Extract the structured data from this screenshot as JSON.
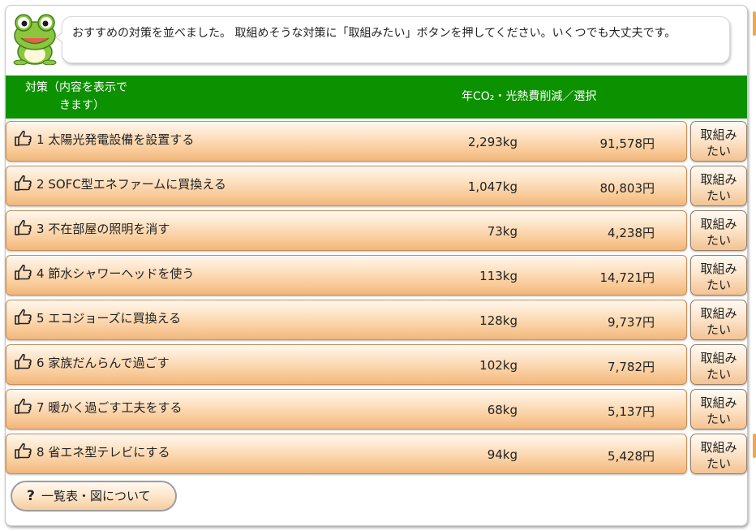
{
  "message": "おすすめの対策を並べました。 取組めそうな対策に「取組みたい」ボタンを押してください。いくつでも大丈夫です。",
  "header": {
    "action_line1": "対策（内容を表示で",
    "action_line2": "きます）",
    "values_label": "年CO₂・光熱費削減／選択"
  },
  "measures": [
    {
      "no": "1",
      "name": "太陽光発電設備を設置する",
      "co2": "2,293kg",
      "yen": "91,578円",
      "button": "取組みたい"
    },
    {
      "no": "2",
      "name": "SOFC型エネファームに買換える",
      "co2": "1,047kg",
      "yen": "80,803円",
      "button": "取組みたい"
    },
    {
      "no": "3",
      "name": "不在部屋の照明を消す",
      "co2": "73kg",
      "yen": "4,238円",
      "button": "取組みたい"
    },
    {
      "no": "4",
      "name": "節水シャワーヘッドを使う",
      "co2": "113kg",
      "yen": "14,721円",
      "button": "取組みたい"
    },
    {
      "no": "5",
      "name": "エコジョーズに買換える",
      "co2": "128kg",
      "yen": "9,737円",
      "button": "取組みたい"
    },
    {
      "no": "6",
      "name": "家族だんらんで過ごす",
      "co2": "102kg",
      "yen": "7,782円",
      "button": "取組みたい"
    },
    {
      "no": "7",
      "name": "暖かく過ごす工夫をする",
      "co2": "68kg",
      "yen": "5,137円",
      "button": "取組みたい"
    },
    {
      "no": "8",
      "name": "省エネ型テレビにする",
      "co2": "94kg",
      "yen": "5,428円",
      "button": "取組みたい"
    }
  ],
  "help": {
    "icon": "?",
    "label": "一覧表・図について"
  },
  "icons": {
    "mascot": "frog-icon",
    "row": "pointing-hand-icon"
  },
  "colors": {
    "header_bg": "#0c9100",
    "row_bg": "#fde3c5",
    "accent": "#f2a64a"
  }
}
